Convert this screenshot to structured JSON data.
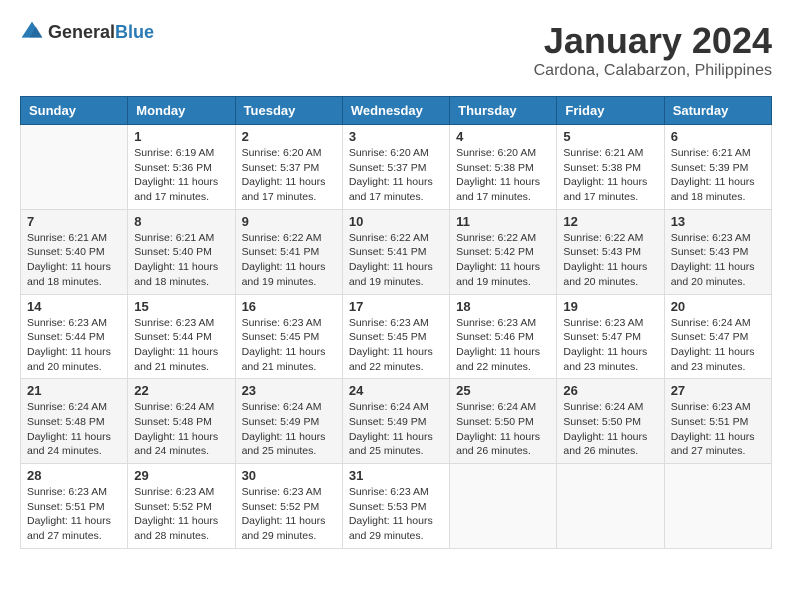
{
  "header": {
    "logo_general": "General",
    "logo_blue": "Blue",
    "month": "January 2024",
    "location": "Cardona, Calabarzon, Philippines"
  },
  "days_of_week": [
    "Sunday",
    "Monday",
    "Tuesday",
    "Wednesday",
    "Thursday",
    "Friday",
    "Saturday"
  ],
  "weeks": [
    [
      {
        "day": "",
        "info": ""
      },
      {
        "day": "1",
        "info": "Sunrise: 6:19 AM\nSunset: 5:36 PM\nDaylight: 11 hours and 17 minutes."
      },
      {
        "day": "2",
        "info": "Sunrise: 6:20 AM\nSunset: 5:37 PM\nDaylight: 11 hours and 17 minutes."
      },
      {
        "day": "3",
        "info": "Sunrise: 6:20 AM\nSunset: 5:37 PM\nDaylight: 11 hours and 17 minutes."
      },
      {
        "day": "4",
        "info": "Sunrise: 6:20 AM\nSunset: 5:38 PM\nDaylight: 11 hours and 17 minutes."
      },
      {
        "day": "5",
        "info": "Sunrise: 6:21 AM\nSunset: 5:38 PM\nDaylight: 11 hours and 17 minutes."
      },
      {
        "day": "6",
        "info": "Sunrise: 6:21 AM\nSunset: 5:39 PM\nDaylight: 11 hours and 18 minutes."
      }
    ],
    [
      {
        "day": "7",
        "info": "Sunrise: 6:21 AM\nSunset: 5:40 PM\nDaylight: 11 hours and 18 minutes."
      },
      {
        "day": "8",
        "info": "Sunrise: 6:21 AM\nSunset: 5:40 PM\nDaylight: 11 hours and 18 minutes."
      },
      {
        "day": "9",
        "info": "Sunrise: 6:22 AM\nSunset: 5:41 PM\nDaylight: 11 hours and 19 minutes."
      },
      {
        "day": "10",
        "info": "Sunrise: 6:22 AM\nSunset: 5:41 PM\nDaylight: 11 hours and 19 minutes."
      },
      {
        "day": "11",
        "info": "Sunrise: 6:22 AM\nSunset: 5:42 PM\nDaylight: 11 hours and 19 minutes."
      },
      {
        "day": "12",
        "info": "Sunrise: 6:22 AM\nSunset: 5:43 PM\nDaylight: 11 hours and 20 minutes."
      },
      {
        "day": "13",
        "info": "Sunrise: 6:23 AM\nSunset: 5:43 PM\nDaylight: 11 hours and 20 minutes."
      }
    ],
    [
      {
        "day": "14",
        "info": "Sunrise: 6:23 AM\nSunset: 5:44 PM\nDaylight: 11 hours and 20 minutes."
      },
      {
        "day": "15",
        "info": "Sunrise: 6:23 AM\nSunset: 5:44 PM\nDaylight: 11 hours and 21 minutes."
      },
      {
        "day": "16",
        "info": "Sunrise: 6:23 AM\nSunset: 5:45 PM\nDaylight: 11 hours and 21 minutes."
      },
      {
        "day": "17",
        "info": "Sunrise: 6:23 AM\nSunset: 5:45 PM\nDaylight: 11 hours and 22 minutes."
      },
      {
        "day": "18",
        "info": "Sunrise: 6:23 AM\nSunset: 5:46 PM\nDaylight: 11 hours and 22 minutes."
      },
      {
        "day": "19",
        "info": "Sunrise: 6:23 AM\nSunset: 5:47 PM\nDaylight: 11 hours and 23 minutes."
      },
      {
        "day": "20",
        "info": "Sunrise: 6:24 AM\nSunset: 5:47 PM\nDaylight: 11 hours and 23 minutes."
      }
    ],
    [
      {
        "day": "21",
        "info": "Sunrise: 6:24 AM\nSunset: 5:48 PM\nDaylight: 11 hours and 24 minutes."
      },
      {
        "day": "22",
        "info": "Sunrise: 6:24 AM\nSunset: 5:48 PM\nDaylight: 11 hours and 24 minutes."
      },
      {
        "day": "23",
        "info": "Sunrise: 6:24 AM\nSunset: 5:49 PM\nDaylight: 11 hours and 25 minutes."
      },
      {
        "day": "24",
        "info": "Sunrise: 6:24 AM\nSunset: 5:49 PM\nDaylight: 11 hours and 25 minutes."
      },
      {
        "day": "25",
        "info": "Sunrise: 6:24 AM\nSunset: 5:50 PM\nDaylight: 11 hours and 26 minutes."
      },
      {
        "day": "26",
        "info": "Sunrise: 6:24 AM\nSunset: 5:50 PM\nDaylight: 11 hours and 26 minutes."
      },
      {
        "day": "27",
        "info": "Sunrise: 6:23 AM\nSunset: 5:51 PM\nDaylight: 11 hours and 27 minutes."
      }
    ],
    [
      {
        "day": "28",
        "info": "Sunrise: 6:23 AM\nSunset: 5:51 PM\nDaylight: 11 hours and 27 minutes."
      },
      {
        "day": "29",
        "info": "Sunrise: 6:23 AM\nSunset: 5:52 PM\nDaylight: 11 hours and 28 minutes."
      },
      {
        "day": "30",
        "info": "Sunrise: 6:23 AM\nSunset: 5:52 PM\nDaylight: 11 hours and 29 minutes."
      },
      {
        "day": "31",
        "info": "Sunrise: 6:23 AM\nSunset: 5:53 PM\nDaylight: 11 hours and 29 minutes."
      },
      {
        "day": "",
        "info": ""
      },
      {
        "day": "",
        "info": ""
      },
      {
        "day": "",
        "info": ""
      }
    ]
  ]
}
